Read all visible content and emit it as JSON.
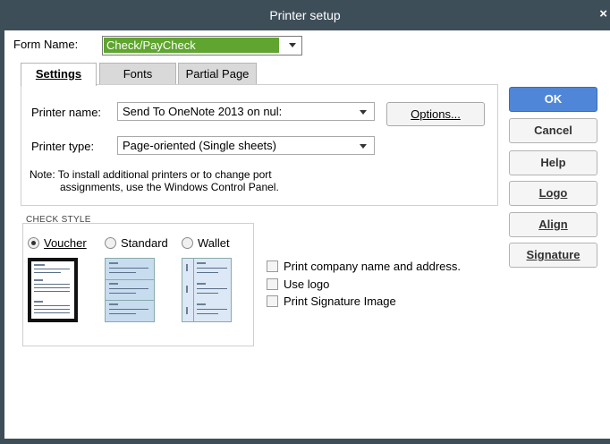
{
  "window": {
    "title": "Printer setup",
    "close_glyph": "×"
  },
  "form_name": {
    "label": "Form Name:",
    "value": "Check/PayCheck"
  },
  "tabs": [
    {
      "label": "Settings",
      "active": true
    },
    {
      "label": "Fonts",
      "active": false
    },
    {
      "label": "Partial Page",
      "active": false
    }
  ],
  "settings": {
    "printer_name_label": "Printer name:",
    "printer_name_value": "Send To OneNote 2013 on nul:",
    "options_label": "Options...",
    "printer_type_label": "Printer type:",
    "printer_type_value": "Page-oriented (Single sheets)",
    "note_line1": "Note: To install additional printers or to change port",
    "note_line2": "assignments, use the Windows Control Panel."
  },
  "check_style": {
    "label": "CHECK STYLE",
    "options": [
      {
        "label": "Voucher",
        "selected": true
      },
      {
        "label": "Standard",
        "selected": false
      },
      {
        "label": "Wallet",
        "selected": false
      }
    ]
  },
  "checkboxes": [
    {
      "label": "Print company name and address.",
      "checked": false
    },
    {
      "label": "Use logo",
      "checked": false
    },
    {
      "label": "Print Signature Image",
      "checked": false
    }
  ],
  "side_buttons": {
    "ok": "OK",
    "cancel": "Cancel",
    "help": "Help",
    "logo": "Logo",
    "align": "Align",
    "signature": "Signature"
  },
  "colors": {
    "titlebar": "#3e4e59",
    "form_name_highlight": "#5fa52f",
    "ok_button": "#4f86d8"
  }
}
